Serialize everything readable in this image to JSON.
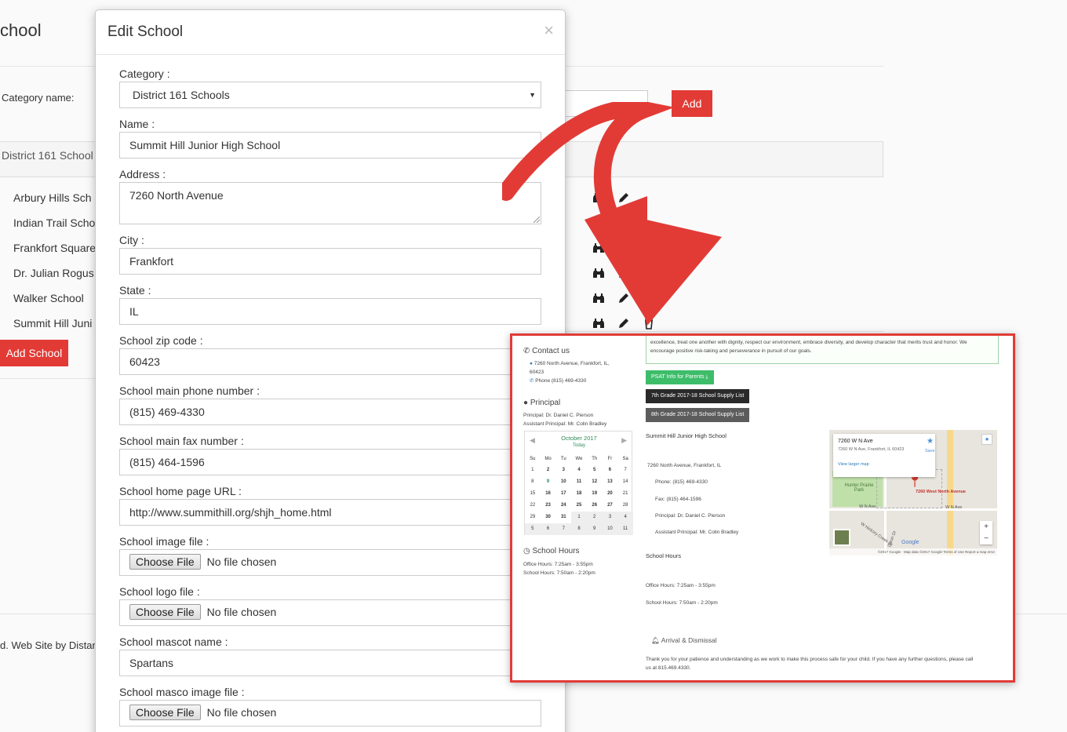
{
  "page": {
    "title": "chool",
    "category_name_label": "Category name:",
    "add_button": "Add",
    "panel_text": "District 161 School",
    "schools": [
      "Arbury Hills Sch",
      "Indian Trail Scho",
      "Frankfort Square",
      "Dr. Julian Rogus",
      "Walker School",
      "Summit Hill Juni"
    ],
    "add_school_button": "Add School",
    "footer_text": "d. Web Site by Distan"
  },
  "modal": {
    "title": "Edit School",
    "close_symbol": "×",
    "fields": {
      "category_label": "Category :",
      "category_value": "District 161 Schools",
      "name_label": "Name :",
      "name_value": "Summit Hill Junior High School",
      "address_label": "Address :",
      "address_value": "7260 North Avenue",
      "city_label": "City :",
      "city_value": "Frankfort",
      "state_label": "State :",
      "state_value": "IL",
      "zip_label": "School zip code :",
      "zip_value": "60423",
      "phone_label": "School main phone number :",
      "phone_value": "(815) 469-4330",
      "fax_label": "School main fax number :",
      "fax_value": "(815) 464-1596",
      "url_label": "School home page URL :",
      "url_value": "http://www.summithill.org/shjh_home.html",
      "image_label": "School image file :",
      "logo_label": "School logo file :",
      "mascot_label": "School mascot name :",
      "mascot_value": "Spartans",
      "mascot_image_label": "School masco image file :"
    },
    "choose_file": "Choose File",
    "no_file": "No file chosen"
  },
  "preview": {
    "intro_line1": "excellence, treat one another with dignity, respect our environment, embrace diversity, and develop character that merits trust and honor. We",
    "intro_line2": "encourage positive risk-taking and perseverance in pursuit of our goals.",
    "contact_heading": "Contact us",
    "contact_address": "7260 North Avenue, Frankfort, IL,",
    "contact_zip": "60423",
    "contact_phone": "Phone (815) 469-4330",
    "principal_heading": "Principal",
    "principal_line": "Principal: Dr. Daniel C. Pierson",
    "assistant_line": "Assistant Principal: Mr. Colin Bradley",
    "calendar_month": "October 2017",
    "calendar_today": "Today",
    "calendar_days": [
      "Su",
      "Mo",
      "Tu",
      "We",
      "Th",
      "Fr",
      "Sa"
    ],
    "calendar_cells": [
      "1",
      "2",
      "3",
      "4",
      "5",
      "6",
      "7",
      "8",
      "9",
      "10",
      "11",
      "12",
      "13",
      "14",
      "15",
      "16",
      "17",
      "18",
      "19",
      "20",
      "21",
      "22",
      "23",
      "24",
      "25",
      "26",
      "27",
      "28",
      "29",
      "30",
      "31",
      "1",
      "2",
      "3",
      "4",
      "5",
      "6",
      "7",
      "8",
      "9",
      "10",
      "11"
    ],
    "hours_heading": "School Hours",
    "office_hours": "Office Hours: 7:25am - 3:55pm",
    "school_hours": "School Hours: 7:50am - 2:20pm",
    "psat_button": "PSAT Info for Parents",
    "grade7_button": "7th Grade 2017-18 School Supply List",
    "grade8_button": "8th Grade 2017-18 School Supply List",
    "school_name": "Summit Hill Junior High School",
    "addr_detail": "7260 North Avenue, Frankfort, IL",
    "phone_detail": "Phone: (815) 469-4330",
    "fax_detail": "Fax: (815) 464-1596",
    "principal_detail": "Principal: Dr. Daniel C. Pierson",
    "assistant_detail": "Assistant Principal: Mr. Colin Bradley",
    "hours_title": "School Hours",
    "office_hours_detail": "Office Hours: 7:25am - 3:55pm",
    "school_hours_detail": "School Hours: 7:50am - 2:20pm",
    "arrival_heading": "Arrival & Dismissal",
    "arrival_line1": "Thank you for your patience and understanding as we work to make this process safe for your child. If you have any further questions, please call",
    "arrival_line2": "us at 815.469.4330.",
    "map_title": "7260 W N Ave",
    "map_address": "7260 W N Ave, Frankfort, IL 60423",
    "map_save": "Save",
    "map_larger": "View larger map",
    "map_pin_label": "7260 West North Avenue",
    "map_park": "Hunter Prairie Park",
    "map_road1": "W N Ave",
    "map_road2": "W N Ave",
    "map_road3": "W Hickory Creek Dr",
    "map_road4": "Dixon Dr",
    "map_footer": "©2017 Google · Map data ©2017 Google   Terms of Use   Report a map error",
    "map_brand": "Google",
    "map_zoom_in": "+",
    "map_zoom_out": "−"
  },
  "colors": {
    "accent_red": "#e23b36",
    "green": "#3dbd6a"
  }
}
